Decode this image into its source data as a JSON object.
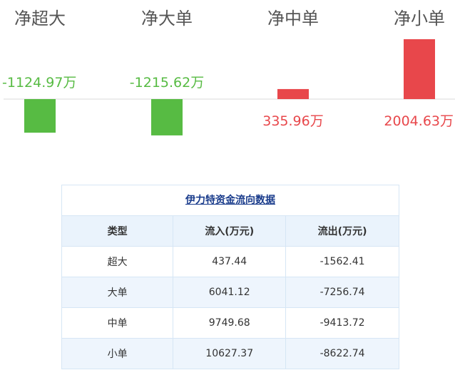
{
  "chart_data": {
    "type": "bar",
    "categories": [
      "净超大",
      "净大单",
      "净中单",
      "净小单"
    ],
    "values": [
      -1124.97,
      -1215.62,
      335.96,
      2004.63
    ],
    "labels": [
      "-1124.97万",
      "-1215.62万",
      "335.96万",
      "2004.63万"
    ],
    "colors": {
      "positive": "#e8474b",
      "negative": "#57bb43",
      "axis": "#d9d9d9",
      "category_text": "#555555"
    }
  },
  "table": {
    "title": "伊力特资金流向数据",
    "headers": [
      "类型",
      "流入(万元)",
      "流出(万元)"
    ],
    "rows": [
      {
        "type": "超大",
        "inflow": "437.44",
        "outflow": "-1562.41"
      },
      {
        "type": "大单",
        "inflow": "6041.12",
        "outflow": "-7256.74"
      },
      {
        "type": "中单",
        "inflow": "9749.68",
        "outflow": "-9413.72"
      },
      {
        "type": "小单",
        "inflow": "10627.37",
        "outflow": "-8622.74"
      }
    ]
  }
}
